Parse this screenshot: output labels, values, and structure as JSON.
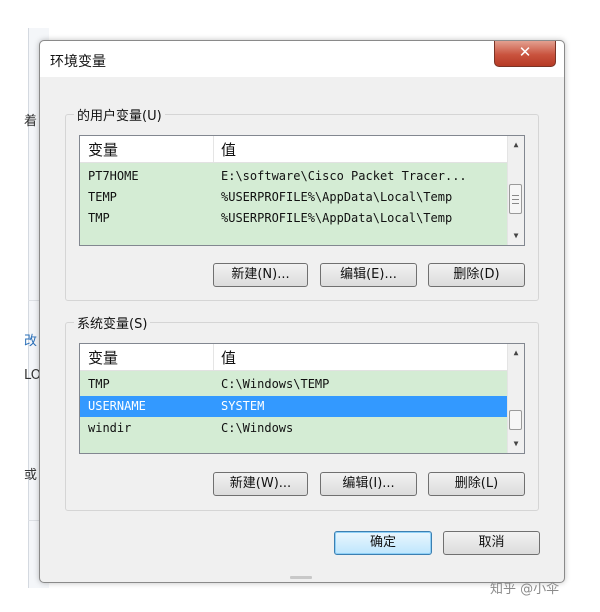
{
  "background": {
    "fragments": [
      "着",
      "改",
      "LO",
      "或"
    ]
  },
  "dialog": {
    "title": "环境变量",
    "close_label": "✕"
  },
  "user_vars": {
    "legend": "的用户变量(U)",
    "columns": {
      "name": "变量",
      "value": "值"
    },
    "rows": [
      {
        "name": "PT7HOME",
        "value": "E:\\software\\Cisco Packet Tracer..."
      },
      {
        "name": "TEMP",
        "value": "%USERPROFILE%\\AppData\\Local\\Temp"
      },
      {
        "name": "TMP",
        "value": "%USERPROFILE%\\AppData\\Local\\Temp"
      }
    ],
    "buttons": {
      "new": "新建(N)...",
      "edit": "编辑(E)...",
      "delete": "删除(D)"
    }
  },
  "system_vars": {
    "legend": "系统变量(S)",
    "columns": {
      "name": "变量",
      "value": "值"
    },
    "rows": [
      {
        "name": "TMP",
        "value": "C:\\Windows\\TEMP"
      },
      {
        "name": "USERNAME",
        "value": "SYSTEM",
        "selected": true
      },
      {
        "name": "windir",
        "value": "C:\\Windows"
      }
    ],
    "buttons": {
      "new": "新建(W)...",
      "edit": "编辑(I)...",
      "delete": "删除(L)"
    }
  },
  "footer": {
    "ok": "确定",
    "cancel": "取消"
  },
  "watermark": "知乎 @小伞",
  "colors": {
    "list_bg": "#d4ecd4",
    "selection": "#3399ff",
    "close": "#c9533e"
  }
}
